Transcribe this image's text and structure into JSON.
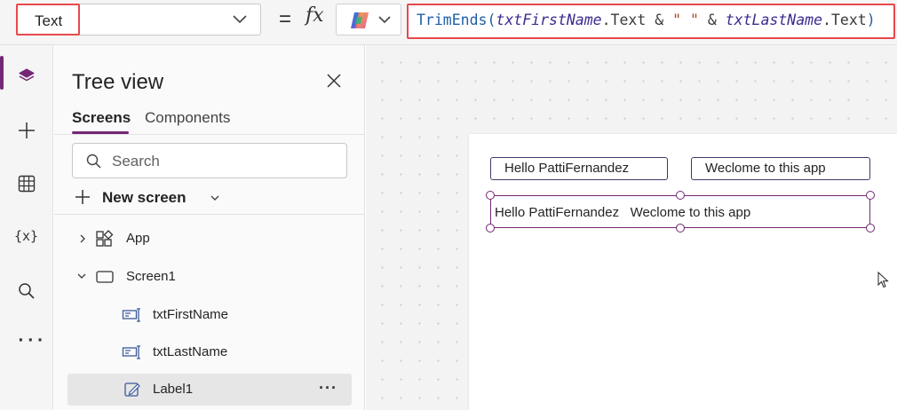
{
  "formula_bar": {
    "property": "Text",
    "equals": "=",
    "fx": "fx",
    "formula": {
      "fn": "TrimEnds(",
      "var1": "txtFirstName",
      "prop1": ".Text",
      "op1": " & ",
      "str": "\" \"",
      "op2": " & ",
      "var2": "txtLastName",
      "prop2": ".Text",
      "close": ")"
    }
  },
  "rail": {
    "items": [
      "layers-icon",
      "plus-icon",
      "table-icon",
      "variables-icon",
      "search-icon",
      "more-icon"
    ],
    "variables_glyph": "{x}",
    "more_glyph": "···"
  },
  "tree_view": {
    "title": "Tree view",
    "tabs": [
      {
        "label": "Screens",
        "active": true
      },
      {
        "label": "Components",
        "active": false
      }
    ],
    "search_placeholder": "Search",
    "new_screen_label": "New screen",
    "nodes": [
      {
        "label": "App",
        "expander": "collapsed"
      },
      {
        "label": "Screen1",
        "expander": "expanded"
      },
      {
        "label": "txtFirstName"
      },
      {
        "label": "txtLastName"
      },
      {
        "label": "Label1",
        "selected": true,
        "more": "···"
      }
    ]
  },
  "canvas": {
    "txt_first_value": "Hello PattiFernandez",
    "txt_last_value": "Weclome to this app",
    "label_text": "Hello PattiFernandez   Weclome to this app"
  },
  "colors": {
    "accent": "#742774",
    "highlight": "#e8494c",
    "function": "#1f5fa8",
    "variable": "#3b2c8f",
    "string": "#b0451f"
  }
}
